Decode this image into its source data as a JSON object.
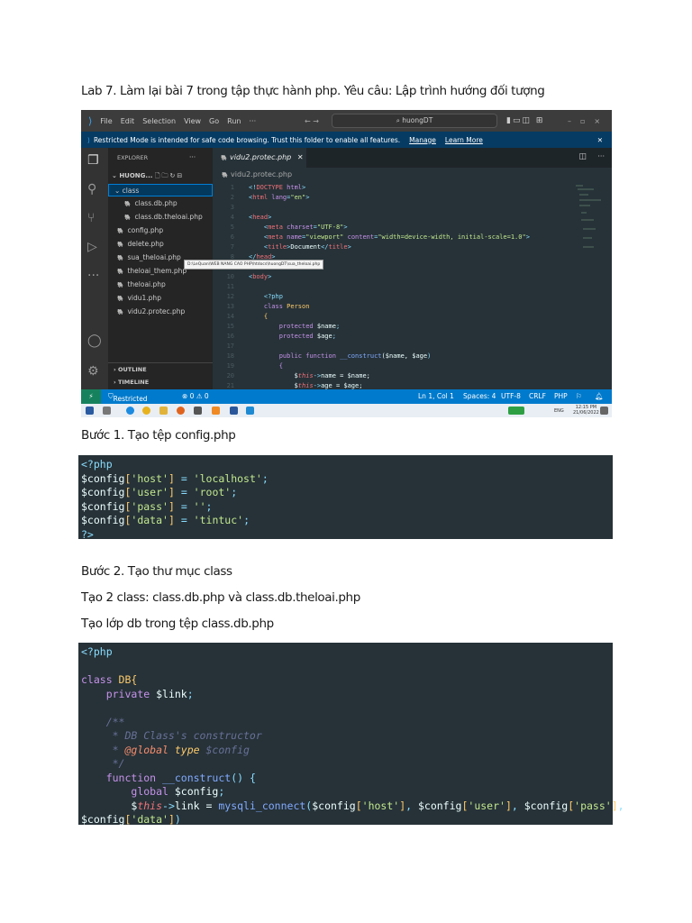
{
  "headings": {
    "lab": "Lab 7. Làm lại bài 7 trong tập thực hành php. Yêu câu: Lập trình hướng đối tượng",
    "step1": "Bước 1. Tạo tệp config.php",
    "step2": "Bước 2. Tạo thư mục class",
    "classes": "Tạo 2 class: class.db.php và class.db.theloai.php",
    "dbclass": "Tạo lớp db trong tệp class.db.php"
  },
  "vscode": {
    "menu": [
      "File",
      "Edit",
      "Selection",
      "View",
      "Go",
      "Run",
      "···"
    ],
    "search": "⌕ huongDT",
    "banner": {
      "text": "Restricted Mode is intended for safe code browsing. Trust this folder to enable all features.",
      "manage": "Manage",
      "learn_more": "Learn More",
      "close": "✕"
    },
    "explorer": {
      "title": "EXPLORER",
      "more": "···",
      "root": "HUONG...",
      "items": [
        "class",
        "class.db.php",
        "class.db.theloai.php",
        "config.php",
        "delete.php",
        "sua_theloai.php",
        "theloai_them.php",
        "theloai.php",
        "vidu1.php",
        "vidu2.protec.php"
      ],
      "outline": "OUTLINE",
      "timeline": "TIMELINE"
    },
    "tab": "vidu2.protec.php",
    "tab_close": "✕",
    "breadcrumb": "vidu2.protec.php",
    "tooltip": "D:\\LeQuan\\WEB NANG CAO PHP\\htdocs\\huongDT\\sua_theloai.php",
    "code": [
      [
        [
          "<!",
          "p"
        ],
        [
          "DOCTYPE",
          "tag"
        ],
        [
          " html",
          "attr"
        ],
        [
          ">",
          "p"
        ]
      ],
      [
        [
          "<",
          "p"
        ],
        [
          "html",
          "tag"
        ],
        [
          " lang",
          "attr"
        ],
        [
          "=",
          "p"
        ],
        [
          "\"en\"",
          "str"
        ],
        [
          ">",
          "p"
        ]
      ],
      [],
      [
        [
          "<",
          "p"
        ],
        [
          "head",
          "tag"
        ],
        [
          ">",
          "p"
        ]
      ],
      [
        [
          "    ",
          ""
        ],
        [
          "<",
          "p"
        ],
        [
          "meta",
          "tag"
        ],
        [
          " charset",
          "attr"
        ],
        [
          "=",
          "p"
        ],
        [
          "\"UTF-8\"",
          "str"
        ],
        [
          ">",
          "p"
        ]
      ],
      [
        [
          "    ",
          ""
        ],
        [
          "<",
          "p"
        ],
        [
          "meta",
          "tag"
        ],
        [
          " name",
          "attr"
        ],
        [
          "=",
          "p"
        ],
        [
          "\"viewport\"",
          "str"
        ],
        [
          " content",
          "attr"
        ],
        [
          "=",
          "p"
        ],
        [
          "\"width=device-width, initial-scale=1.0\"",
          "str"
        ],
        [
          ">",
          "p"
        ]
      ],
      [
        [
          "    ",
          ""
        ],
        [
          "<",
          "p"
        ],
        [
          "title",
          "tag"
        ],
        [
          ">",
          "p"
        ],
        [
          "Document",
          ""
        ],
        [
          "</",
          "p"
        ],
        [
          "title",
          "tag"
        ],
        [
          ">",
          "p"
        ]
      ],
      [
        [
          "</",
          "p"
        ],
        [
          "head",
          "tag"
        ],
        [
          ">",
          "p"
        ]
      ],
      [],
      [
        [
          "<",
          "p"
        ],
        [
          "body",
          "tag"
        ],
        [
          ">",
          "p"
        ]
      ],
      [],
      [
        [
          "    ",
          ""
        ],
        [
          "<?php",
          "p"
        ]
      ],
      [
        [
          "    ",
          ""
        ],
        [
          "class",
          "kw"
        ],
        [
          " Person",
          "cls"
        ]
      ],
      [
        [
          "    ",
          ""
        ],
        [
          "{",
          "cls"
        ]
      ],
      [
        [
          "        ",
          ""
        ],
        [
          "protected",
          "kw"
        ],
        [
          " $name",
          ""
        ],
        [
          ";",
          "p"
        ]
      ],
      [
        [
          "        ",
          ""
        ],
        [
          "protected",
          "kw"
        ],
        [
          " $age",
          ""
        ],
        [
          ";",
          "p"
        ]
      ],
      [],
      [
        [
          "        ",
          ""
        ],
        [
          "public function",
          "kw"
        ],
        [
          " __construct",
          "fn"
        ],
        [
          "(",
          ""
        ],
        [
          "$name, $age",
          ""
        ],
        [
          ")",
          "p"
        ]
      ],
      [
        [
          "        ",
          ""
        ],
        [
          "{",
          "attr"
        ]
      ],
      [
        [
          "            ",
          ""
        ],
        [
          "$",
          "var"
        ],
        [
          "this",
          "this"
        ],
        [
          "->",
          "p"
        ],
        [
          "name = $name;",
          ""
        ]
      ],
      [
        [
          "            ",
          ""
        ],
        [
          "$",
          "var"
        ],
        [
          "this",
          "this"
        ],
        [
          "->",
          "p"
        ],
        [
          "age = $age;",
          ""
        ]
      ]
    ],
    "status": {
      "remote": "⚡",
      "restricted": "Restricted Mode",
      "problems": "⊗ 0 ⚠ 0",
      "position": "Ln 1, Col 1",
      "spaces": "Spaces: 4",
      "encoding": "UTF-8",
      "eol": "CRLF",
      "language": "PHP"
    },
    "taskbar": {
      "lang": "ENG",
      "time": "12:15 PM",
      "date": "21/06/2022"
    }
  },
  "config_code": [
    [
      [
        "<?php",
        "p"
      ]
    ],
    [
      [
        "$config",
        "var"
      ],
      [
        "[",
        "cls"
      ],
      [
        "'host'",
        "str"
      ],
      [
        "]",
        "cls"
      ],
      [
        " = ",
        "p"
      ],
      [
        "'localhost'",
        "str"
      ],
      [
        ";",
        "p"
      ]
    ],
    [
      [
        "$config",
        "var"
      ],
      [
        "[",
        "cls"
      ],
      [
        "'user'",
        "str"
      ],
      [
        "]",
        "cls"
      ],
      [
        " = ",
        "p"
      ],
      [
        "'root'",
        "str"
      ],
      [
        ";",
        "p"
      ]
    ],
    [
      [
        "$config",
        "var"
      ],
      [
        "[",
        "cls"
      ],
      [
        "'pass'",
        "str"
      ],
      [
        "]",
        "cls"
      ],
      [
        " = ",
        "p"
      ],
      [
        "''",
        "str"
      ],
      [
        ";",
        "p"
      ]
    ],
    [
      [
        "$config",
        "var"
      ],
      [
        "[",
        "cls"
      ],
      [
        "'data'",
        "str"
      ],
      [
        "]",
        "cls"
      ],
      [
        " = ",
        "p"
      ],
      [
        "'tintuc'",
        "str"
      ],
      [
        ";",
        "p"
      ]
    ],
    [
      [
        "?>",
        "p"
      ]
    ]
  ],
  "db_code": [
    [
      [
        "<?php",
        "p"
      ]
    ],
    [],
    [
      [
        "class",
        "kw"
      ],
      [
        " DB",
        "cls"
      ],
      [
        "{",
        "cls"
      ]
    ],
    [
      [
        "    ",
        ""
      ],
      [
        "private",
        "kw"
      ],
      [
        " $link",
        ""
      ],
      [
        ";",
        "p"
      ]
    ],
    [],
    [
      [
        "    /**",
        "cm"
      ]
    ],
    [
      [
        "     * DB Class's constructor",
        "cm"
      ]
    ],
    [
      [
        "     * ",
        "cm"
      ],
      [
        "@global",
        "doc"
      ],
      [
        " type",
        "type"
      ],
      [
        " $config",
        "cm"
      ]
    ],
    [
      [
        "     */",
        "cm"
      ]
    ],
    [
      [
        "    ",
        ""
      ],
      [
        "function",
        "kw"
      ],
      [
        " __construct",
        "fn"
      ],
      [
        "() {",
        "p"
      ]
    ],
    [
      [
        "        ",
        ""
      ],
      [
        "global",
        "kw"
      ],
      [
        " $config",
        ""
      ],
      [
        ";",
        "p"
      ]
    ],
    [
      [
        "        ",
        ""
      ],
      [
        "$",
        "var"
      ],
      [
        "this",
        "this"
      ],
      [
        "->",
        "p"
      ],
      [
        "link = ",
        ""
      ],
      [
        "mysqli_connect",
        "fn"
      ],
      [
        "(",
        "p"
      ],
      [
        "$config",
        "var"
      ],
      [
        "[",
        "cls"
      ],
      [
        "'host'",
        "str"
      ],
      [
        "]",
        "cls"
      ],
      [
        ", ",
        "p"
      ],
      [
        "$config",
        "var"
      ],
      [
        "[",
        "cls"
      ],
      [
        "'user'",
        "str"
      ],
      [
        "]",
        "cls"
      ],
      [
        ", ",
        "p"
      ],
      [
        "$config",
        "var"
      ],
      [
        "[",
        "cls"
      ],
      [
        "'pass'",
        "str"
      ],
      [
        "]",
        "cls"
      ],
      [
        ",",
        "p"
      ]
    ],
    [
      [
        "$config",
        "var"
      ],
      [
        "[",
        "cls"
      ],
      [
        "'data'",
        "str"
      ],
      [
        "]",
        "cls"
      ],
      [
        ")",
        "p"
      ]
    ]
  ]
}
